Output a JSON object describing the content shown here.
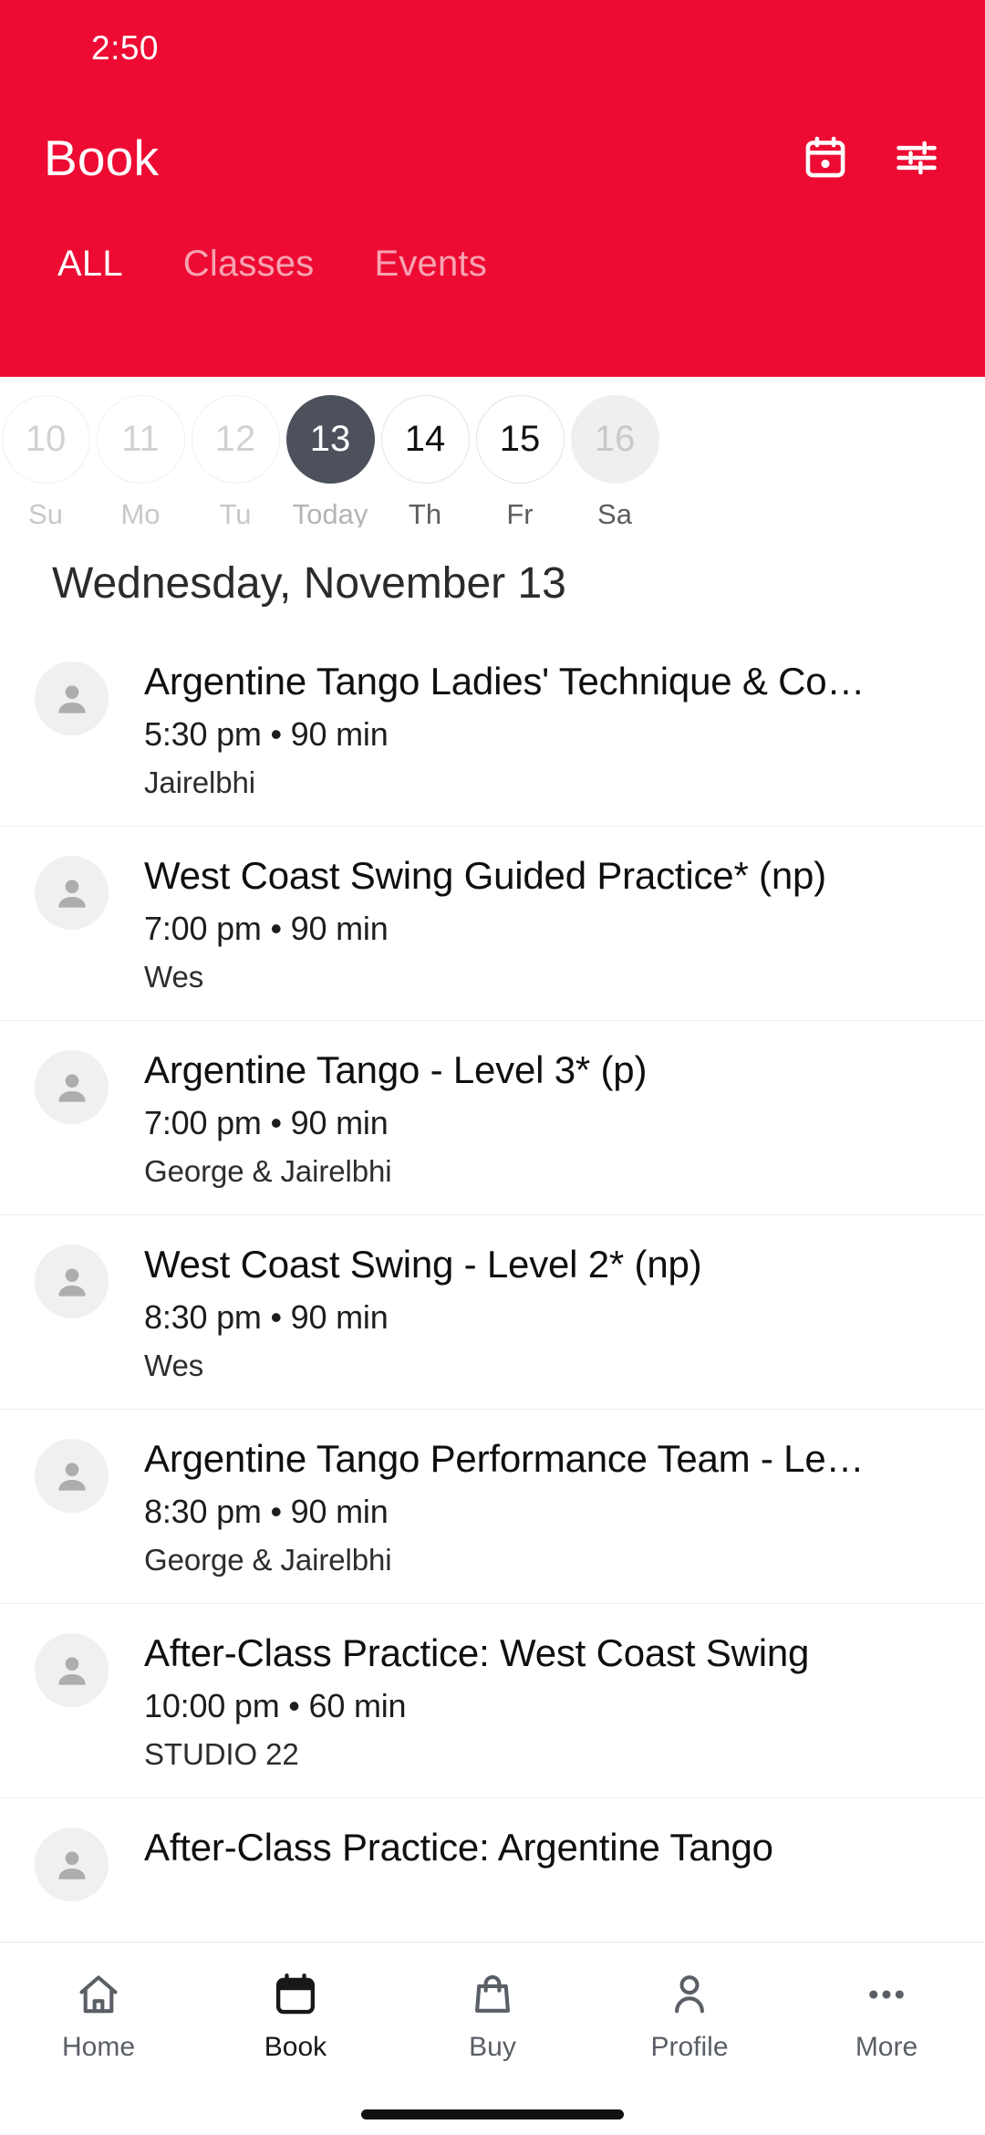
{
  "status_bar": {
    "time": "2:50"
  },
  "header": {
    "title": "Book",
    "background_color": "#ED0B33",
    "actions": [
      {
        "name": "calendar-icon",
        "label": "Calendar"
      },
      {
        "name": "filter-icon",
        "label": "Filters"
      }
    ],
    "tabs": [
      {
        "label": "ALL",
        "active": true
      },
      {
        "label": "Classes",
        "active": false
      },
      {
        "label": "Events",
        "active": false
      }
    ]
  },
  "date_strip": {
    "selected_color": "#4C515C",
    "days": [
      {
        "num": "10",
        "label": "Su",
        "state": "past"
      },
      {
        "num": "11",
        "label": "Mo",
        "state": "past"
      },
      {
        "num": "12",
        "label": "Tu",
        "state": "past"
      },
      {
        "num": "13",
        "label": "Today",
        "state": "selected"
      },
      {
        "num": "14",
        "label": "Th",
        "state": "available"
      },
      {
        "num": "15",
        "label": "Fr",
        "state": "available"
      },
      {
        "num": "16",
        "label": "Sa",
        "state": "pressed"
      }
    ]
  },
  "schedule": {
    "date_heading": "Wednesday, November 13",
    "classes": [
      {
        "title": "Argentine Tango Ladies' Technique & Co…",
        "time": "5:30 pm",
        "duration": "90 min",
        "meta": "5:30 pm • 90 min",
        "staff": "Jairelbhi"
      },
      {
        "title": "West Coast Swing Guided Practice* (np)",
        "time": "7:00 pm",
        "duration": "90 min",
        "meta": "7:00 pm • 90 min",
        "staff": "Wes"
      },
      {
        "title": "Argentine Tango - Level 3* (p)",
        "time": "7:00 pm",
        "duration": "90 min",
        "meta": "7:00 pm • 90 min",
        "staff": "George & Jairelbhi"
      },
      {
        "title": "West Coast Swing - Level 2* (np)",
        "time": "8:30 pm",
        "duration": "90 min",
        "meta": "8:30 pm • 90 min",
        "staff": "Wes"
      },
      {
        "title": "Argentine Tango Performance Team - Le…",
        "time": "8:30 pm",
        "duration": "90 min",
        "meta": "8:30 pm • 90 min",
        "staff": "George & Jairelbhi"
      },
      {
        "title": "After-Class Practice: West Coast Swing",
        "time": "10:00 pm",
        "duration": "60 min",
        "meta": "10:00 pm • 60 min",
        "staff": "STUDIO 22"
      },
      {
        "title": "After-Class Practice: Argentine Tango",
        "time": "",
        "duration": "",
        "meta": "",
        "staff": ""
      }
    ]
  },
  "bottom_nav": {
    "items": [
      {
        "label": "Home",
        "icon": "home-icon",
        "active": false
      },
      {
        "label": "Book",
        "icon": "calendar-icon",
        "active": true
      },
      {
        "label": "Buy",
        "icon": "shopping-bag-icon",
        "active": false
      },
      {
        "label": "Profile",
        "icon": "person-icon",
        "active": false
      },
      {
        "label": "More",
        "icon": "ellipsis-icon",
        "active": false
      }
    ]
  }
}
